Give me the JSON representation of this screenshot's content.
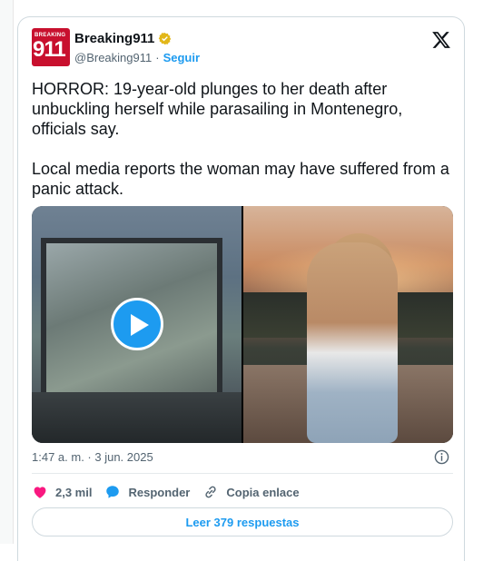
{
  "account": {
    "avatar_small": "BREAKING",
    "avatar_big": "911",
    "name": "Breaking911",
    "handle": "@Breaking911",
    "separator": "·",
    "follow_label": "Seguir"
  },
  "tweet": {
    "text": "HORROR: 19-year-old plunges to her death after unbuckling herself while parasailing in Montenegro, officials say.\n\nLocal media reports the woman may have suffered from a panic attack.",
    "timestamp": "1:47 a. m. · 3 jun. 2025"
  },
  "actions": {
    "likes_count": "2,3 mil",
    "reply_label": "Responder",
    "copy_link_label": "Copia enlace"
  },
  "replies_button": "Leer 379 respuestas",
  "icons": {
    "verified": "verified-badge-icon",
    "x": "x-logo-icon",
    "play": "play-icon",
    "info": "info-icon",
    "heart": "heart-icon",
    "reply": "reply-bubble-icon",
    "link": "link-icon"
  },
  "colors": {
    "accent": "#1d9bf0",
    "heart": "#f91880",
    "verified": "#e2b719",
    "avatar_bg": "#c8102e"
  }
}
